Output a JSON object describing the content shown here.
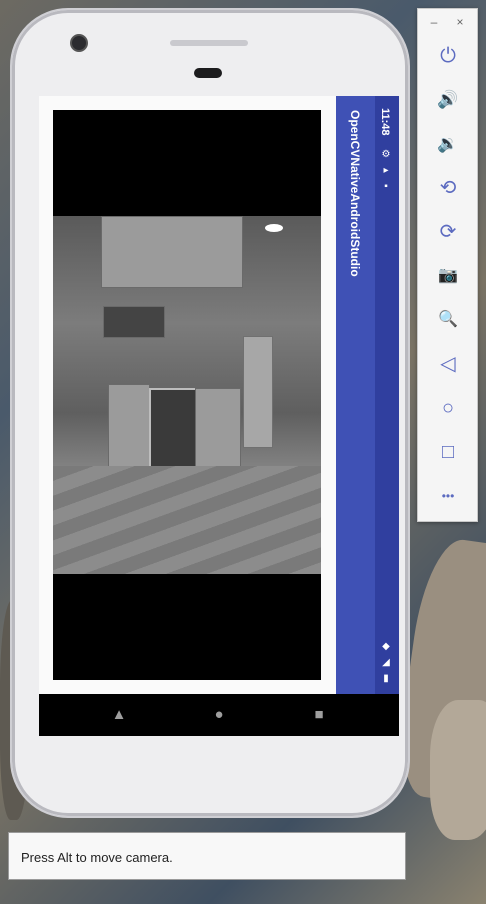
{
  "emulator": {
    "app_title": "OpenCVNativeAndroidStudio",
    "status_bar": {
      "time": "11:48",
      "icons": [
        "gear-icon",
        "terminal-icon",
        "sd-card-icon",
        "wifi-icon",
        "signal-icon",
        "battery-icon"
      ]
    },
    "nav_bar": [
      "back-icon",
      "home-icon",
      "recents-icon"
    ]
  },
  "side_panel": {
    "window_controls": [
      "minimize-icon",
      "close-icon"
    ],
    "window_control_glyphs": {
      "minimize": "–",
      "close": "×"
    },
    "buttons": [
      {
        "name": "power-button",
        "icon": "power-icon",
        "glyph": "⏻"
      },
      {
        "name": "volume-up-button",
        "icon": "volume-up-icon",
        "glyph": "🔊"
      },
      {
        "name": "volume-down-button",
        "icon": "volume-down-icon",
        "glyph": "🔉"
      },
      {
        "name": "rotate-left-button",
        "icon": "rotate-left-icon",
        "glyph": "⟲"
      },
      {
        "name": "rotate-right-button",
        "icon": "rotate-right-icon",
        "glyph": "⟳"
      },
      {
        "name": "screenshot-button",
        "icon": "camera-icon",
        "glyph": "📷"
      },
      {
        "name": "zoom-button",
        "icon": "zoom-in-icon",
        "glyph": "🔍"
      },
      {
        "name": "back-button",
        "icon": "back-icon",
        "glyph": "◁"
      },
      {
        "name": "home-button",
        "icon": "home-icon",
        "glyph": "○"
      },
      {
        "name": "overview-button",
        "icon": "overview-icon",
        "glyph": "□"
      },
      {
        "name": "more-button",
        "icon": "more-icon",
        "glyph": "•••"
      }
    ]
  },
  "hint": {
    "text": "Press Alt to move camera."
  },
  "colors": {
    "app_bar": "#3f51b5",
    "status_bar": "#303f9f",
    "panel_icon": "#5c6bc0"
  }
}
